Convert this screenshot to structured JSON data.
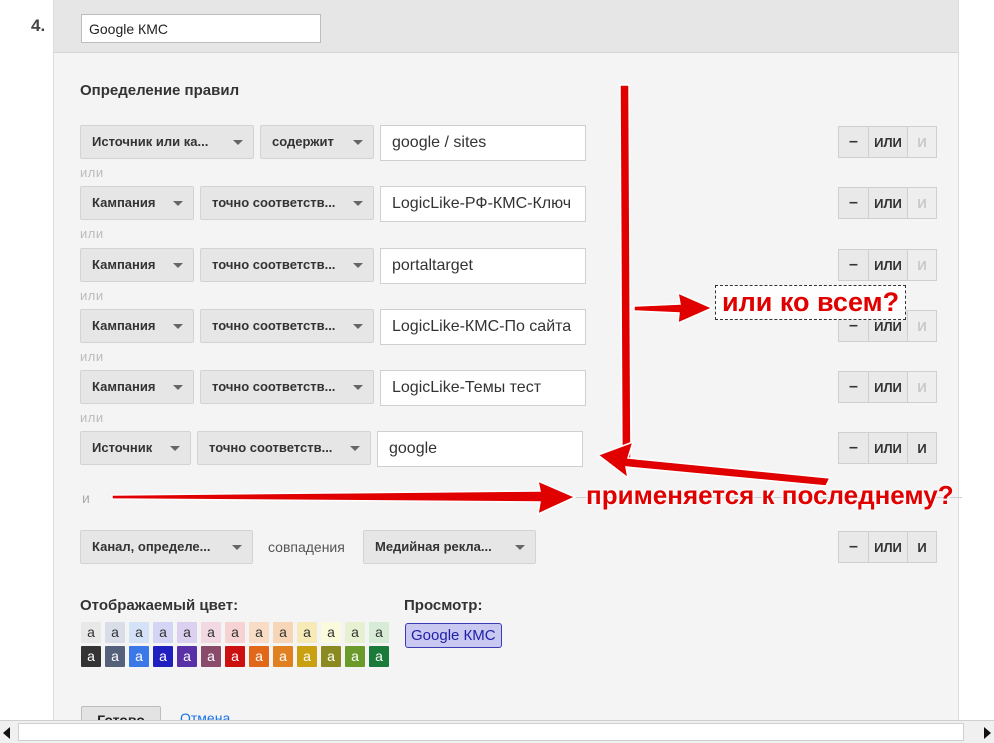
{
  "step": {
    "number": "4."
  },
  "segment": {
    "name": "Google КМС"
  },
  "rules": {
    "title": "Определение правил",
    "or_label": "или",
    "and_label": "и",
    "rows": [
      {
        "dimension": "Источник или ка...",
        "operator": "содержит",
        "value": "google / sites"
      },
      {
        "dimension": "Кампания",
        "operator": "точно соответств...",
        "value": "LogicLike-РФ-КМС-Ключ"
      },
      {
        "dimension": "Кампания",
        "operator": "точно соответств...",
        "value": "portaltarget"
      },
      {
        "dimension": "Кампания",
        "operator": "точно соответств...",
        "value": "LogicLike-КМС-По сайта"
      },
      {
        "dimension": "Кампания",
        "operator": "точно соответств...",
        "value": "LogicLike-Темы тест"
      },
      {
        "dimension": "Источник",
        "operator": "точно соответств...",
        "value": "google"
      }
    ],
    "channel_row": {
      "dimension": "Канал, определе...",
      "operator": "совпадения",
      "value": "Медийная рекла..."
    },
    "buttons": {
      "minus": "–",
      "or": "ИЛИ",
      "and": "И"
    }
  },
  "color_section": {
    "title": "Отображаемый цвет:",
    "swatch_letter": "a",
    "light": [
      "#e8e8e8",
      "#d8dde8",
      "#d4e2f8",
      "#d4d4f4",
      "#dcd0f0",
      "#f2d8e2",
      "#f6d2d2",
      "#f8dcc6",
      "#f6d6b6",
      "#f6eab6",
      "#fafadc",
      "#e8f0d2",
      "#d6ecd6"
    ],
    "dark": [
      "#333333",
      "#55607a",
      "#3b78e7",
      "#2020c0",
      "#5a30a8",
      "#8a4a6a",
      "#cc1010",
      "#e06818",
      "#e08020",
      "#c8a010",
      "#8a8a20",
      "#6a9a2a",
      "#1a7a3a"
    ]
  },
  "preview": {
    "title": "Просмотр:",
    "badge": "Google КМС"
  },
  "actions": {
    "done": "Готово",
    "cancel": "Отмена"
  },
  "annotations": {
    "note_all": "или ко всем?",
    "note_last": "применяется к последнему?",
    "color": "#e00000"
  }
}
